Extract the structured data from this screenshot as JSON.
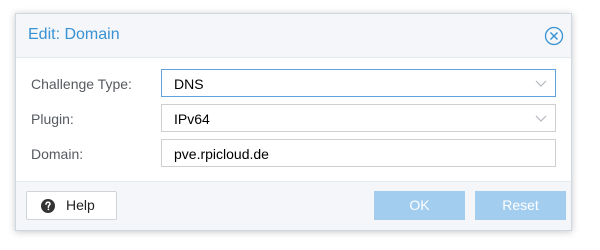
{
  "dialog": {
    "title": "Edit: Domain",
    "close_icon": "close-circle-icon"
  },
  "form": {
    "challenge_type": {
      "label": "Challenge Type:",
      "value": "DNS",
      "icon": "chevron-down-icon"
    },
    "plugin": {
      "label": "Plugin:",
      "value": "IPv64",
      "icon": "chevron-down-icon"
    },
    "domain": {
      "label": "Domain:",
      "value": "pve.rpicloud.de"
    }
  },
  "footer": {
    "help_label": "Help",
    "help_icon": "question-circle-icon",
    "ok_label": "OK",
    "reset_label": "Reset"
  },
  "colors": {
    "title": "#3892d4",
    "focus_border": "#5fa2dd",
    "disabled_button": "#a3cdef",
    "header_footer_bg": "#f4f6f9"
  }
}
